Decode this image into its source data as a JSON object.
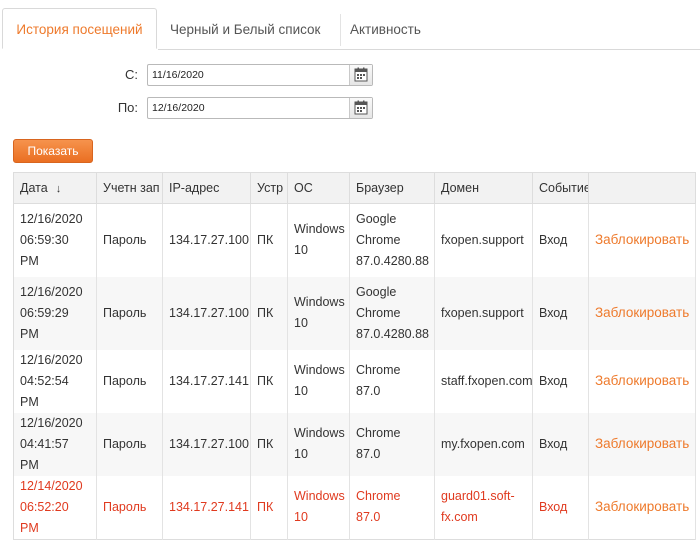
{
  "tabs": [
    {
      "label": "История посещений",
      "active": true
    },
    {
      "label": "Черный и Белый список",
      "active": false
    },
    {
      "label": "Активность",
      "active": false
    }
  ],
  "filter": {
    "from_label": "С:",
    "from_value": "11/16/2020",
    "to_label": "По:",
    "to_value": "12/16/2020",
    "show_button": "Показать"
  },
  "table": {
    "columns": [
      "Дата",
      "Учетн зап",
      "IP-адрес",
      "Устр",
      "ОС",
      "Браузер",
      "Домен",
      "Событие",
      ""
    ],
    "sort_indicator": "↓",
    "rows": [
      {
        "date": "12/16/2020",
        "time": "06:59:30 PM",
        "account": "Пароль",
        "ip": "134.17.27.100",
        "device": "ПК",
        "os1": "Windows",
        "os2": "10",
        "browser": [
          "Google",
          "Chrome",
          "87.0.4280.88"
        ],
        "domain": [
          "fxopen.support"
        ],
        "event": "Вход",
        "action": "Заблокировать",
        "highlight": false
      },
      {
        "date": "12/16/2020",
        "time": "06:59:29 PM",
        "account": "Пароль",
        "ip": "134.17.27.100",
        "device": "ПК",
        "os1": "Windows",
        "os2": "10",
        "browser": [
          "Google",
          "Chrome",
          "87.0.4280.88"
        ],
        "domain": [
          "fxopen.support"
        ],
        "event": "Вход",
        "action": "Заблокировать",
        "highlight": false
      },
      {
        "date": "12/16/2020",
        "time": "04:52:54 PM",
        "account": "Пароль",
        "ip": "134.17.27.141",
        "device": "ПК",
        "os1": "Windows",
        "os2": "10",
        "browser": [
          "Chrome 87.0"
        ],
        "domain": [
          "staff.fxopen.com"
        ],
        "event": "Вход",
        "action": "Заблокировать",
        "highlight": false
      },
      {
        "date": "12/16/2020",
        "time": "04:41:57 PM",
        "account": "Пароль",
        "ip": "134.17.27.100",
        "device": "ПК",
        "os1": "Windows",
        "os2": "10",
        "browser": [
          "Chrome 87.0"
        ],
        "domain": [
          "my.fxopen.com"
        ],
        "event": "Вход",
        "action": "Заблокировать",
        "highlight": false
      },
      {
        "date": "12/14/2020",
        "time": "06:52:20 PM",
        "account": "Пароль",
        "ip": "134.17.27.141",
        "device": "ПК",
        "os1": "Windows",
        "os2": "10",
        "browser": [
          "Chrome 87.0"
        ],
        "domain": [
          "guard01.soft-",
          "fx.com"
        ],
        "event": "Вход",
        "action": "Заблокировать",
        "highlight": true
      }
    ]
  },
  "colors": {
    "accent": "#ee7a2c",
    "warning_text": "#e03a1f",
    "header_bg": "#f2f2f2",
    "alt_row_bg": "#f7f7f7"
  },
  "icons": {
    "calendar": "calendar-icon",
    "sort": "sort-desc-icon"
  }
}
